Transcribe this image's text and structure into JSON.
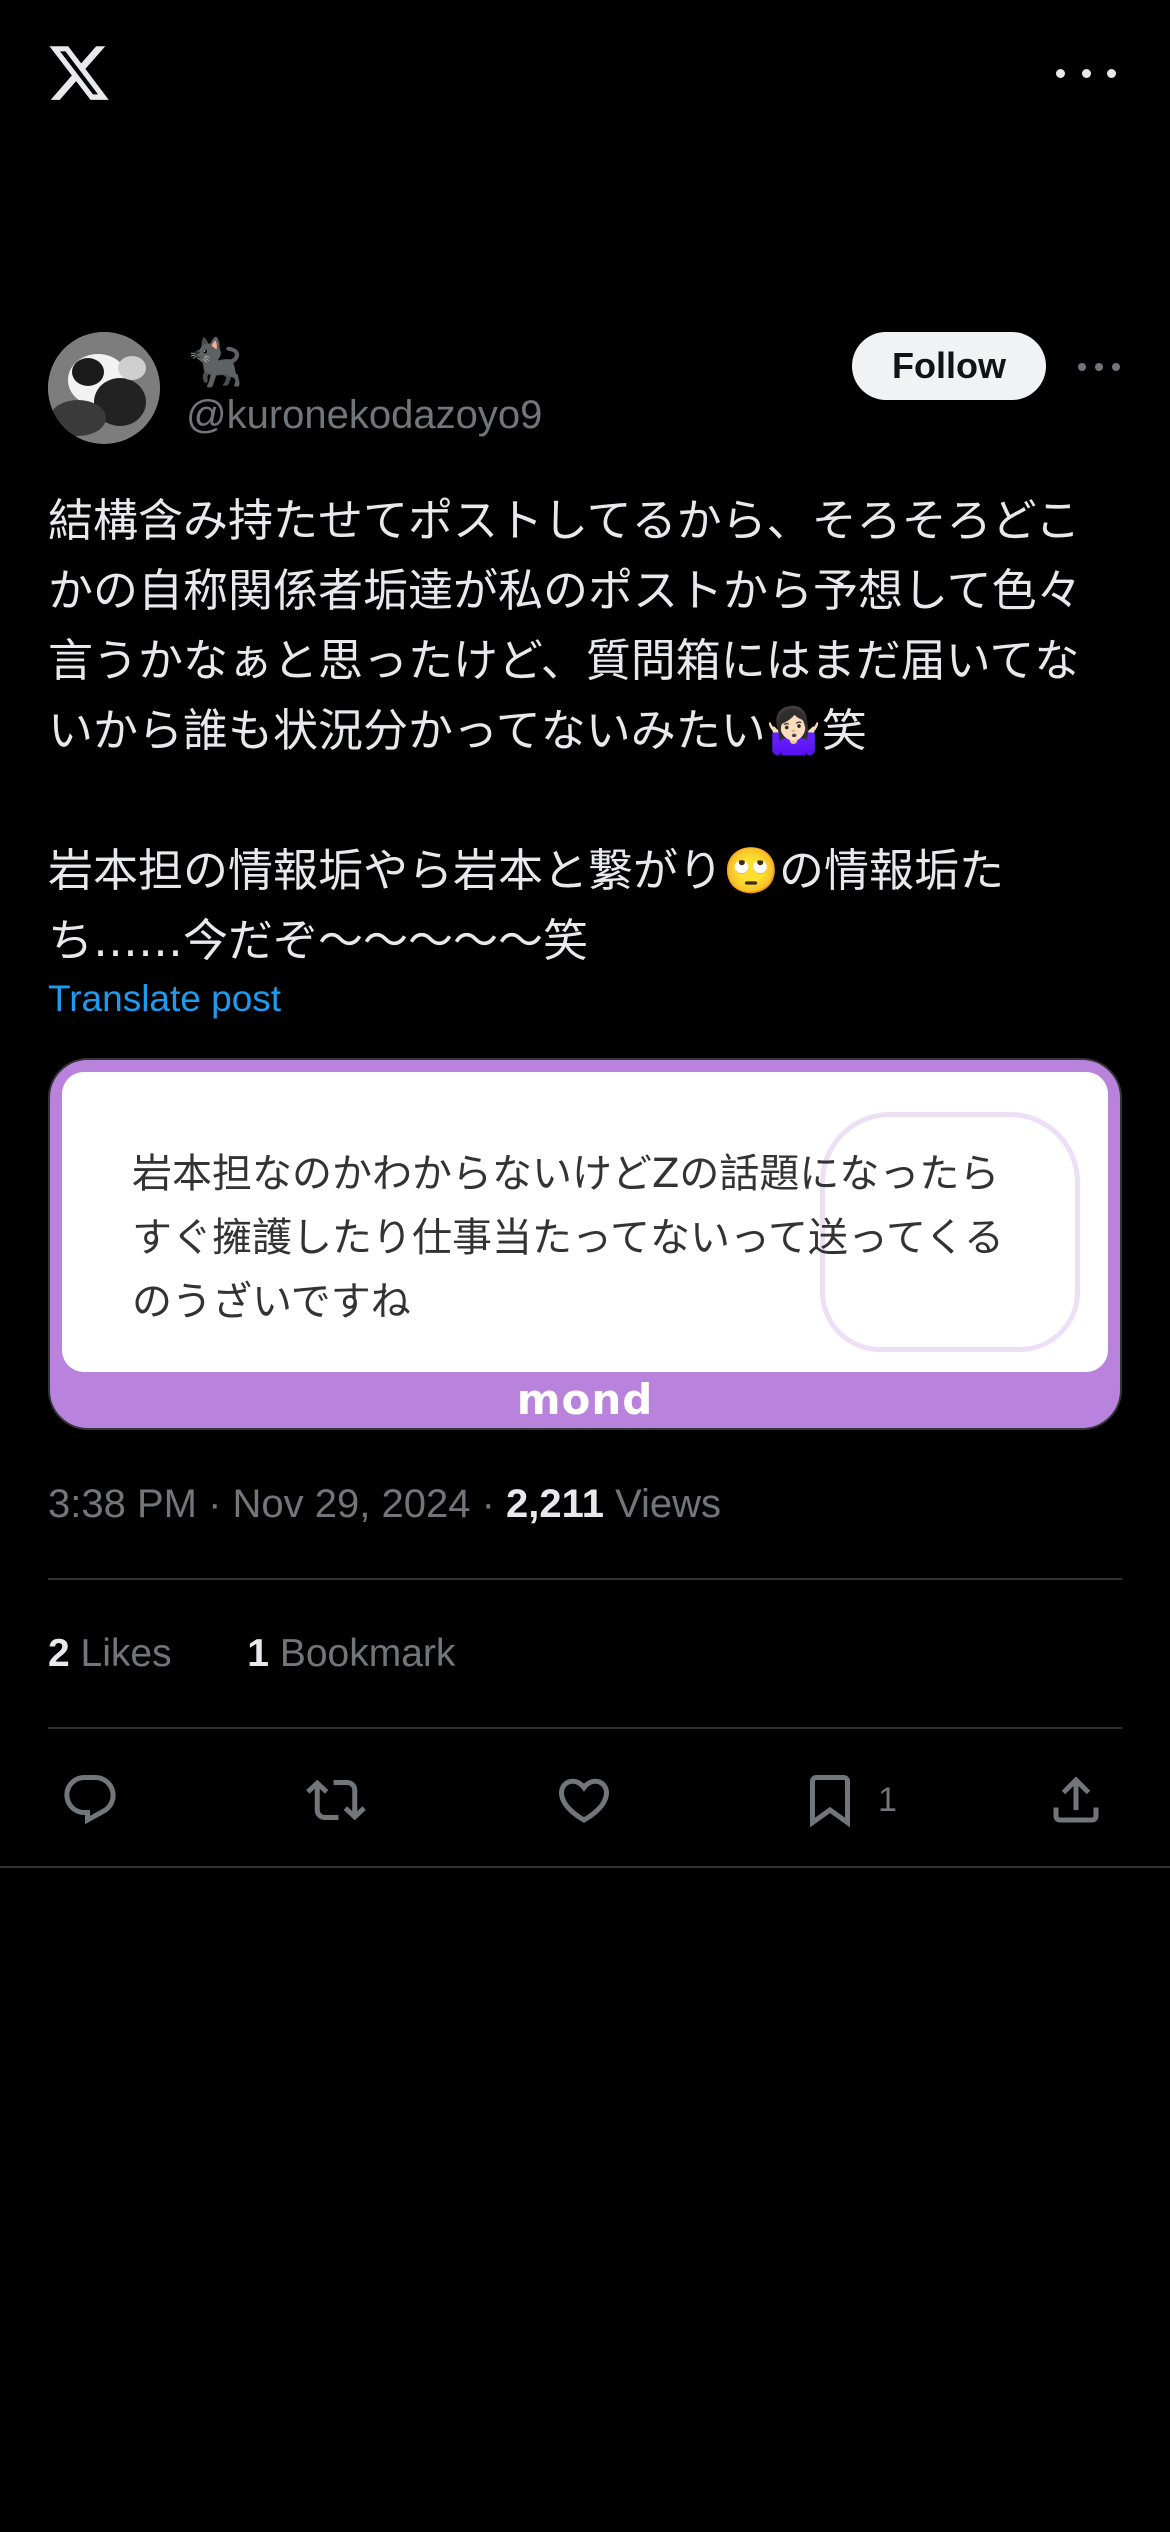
{
  "header": {
    "logo_icon": "x-logo-icon",
    "more_icon": "more-horizontal-icon"
  },
  "author": {
    "display_name": "🐈‍⬛",
    "handle": "@kuronekodazoyo9",
    "follow_label": "Follow",
    "more_icon": "more-horizontal-icon"
  },
  "post": {
    "text": "結構含み持たせてポストしてるから、そろそろどこかの自称関係者垢達が私のポストから予想して色々言うかなぁと思ったけど、質問箱にはまだ届いてないから誰も状況分かってないみたい🤷🏻‍♀️笑\n\n岩本担の情報垢やら岩本と繋がり🙄の情報垢たち……今だぞ〜〜〜〜〜笑",
    "translate_label": "Translate post"
  },
  "media": {
    "card_text": "岩本担なのかわからないけどZの話題になったらすぐ擁護したり仕事当たってないって送ってくるのうざいですね",
    "brand": "mond",
    "colors": {
      "frame": "#b982dc"
    }
  },
  "meta": {
    "time": "3:38 PM",
    "date": "Nov 29, 2024",
    "views_count": "2,211",
    "views_label": "Views"
  },
  "stats": {
    "likes_count": "2",
    "likes_label": "Likes",
    "bookmarks_count": "1",
    "bookmarks_label": "Bookmark"
  },
  "actions": {
    "reply_icon": "reply-icon",
    "repost_icon": "repost-icon",
    "like_icon": "heart-icon",
    "bookmark_icon": "bookmark-icon",
    "bookmark_count": "1",
    "share_icon": "share-icon"
  },
  "colors": {
    "background": "#000000",
    "text": "#e7e9ea",
    "secondary": "#71767b",
    "link": "#1d9bf0",
    "divider": "#2f3336"
  }
}
